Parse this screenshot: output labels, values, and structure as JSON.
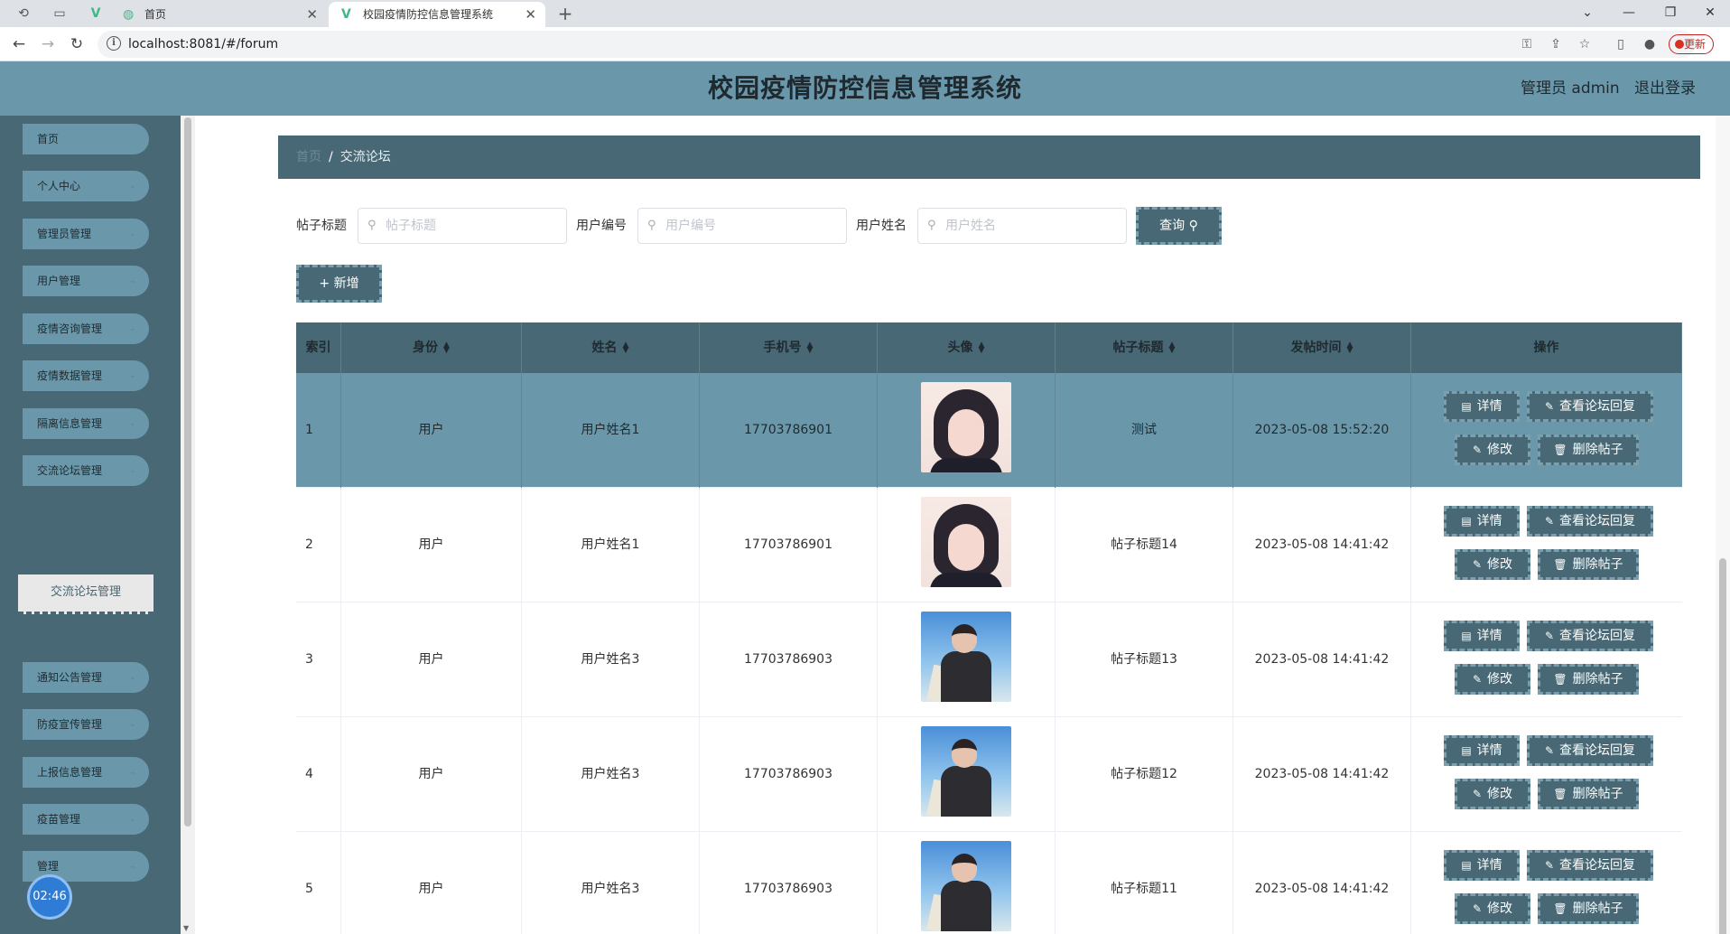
{
  "browser": {
    "tabs": [
      {
        "title": "首页",
        "active": false
      },
      {
        "title": "校园疫情防控信息管理系统",
        "active": true
      }
    ],
    "url": "localhost:8081/#/forum",
    "update_label": "更新"
  },
  "header": {
    "title": "校园疫情防控信息管理系统",
    "admin": "管理员 admin",
    "logout": "退出登录"
  },
  "sidebar": {
    "items": [
      {
        "label": "首页",
        "has_children": false
      },
      {
        "label": "个人中心",
        "has_children": true
      },
      {
        "label": "管理员管理",
        "has_children": true
      },
      {
        "label": "用户管理",
        "has_children": true
      },
      {
        "label": "疫情咨询管理",
        "has_children": true
      },
      {
        "label": "疫情数据管理",
        "has_children": true
      },
      {
        "label": "隔离信息管理",
        "has_children": true
      },
      {
        "label": "交流论坛管理",
        "has_children": true
      },
      {
        "label": "通知公告管理",
        "has_children": true
      },
      {
        "label": "防疫宣传管理",
        "has_children": true
      },
      {
        "label": "上报信息管理",
        "has_children": true
      },
      {
        "label": "疫苗管理",
        "has_children": true
      },
      {
        "label": "管理",
        "has_children": true
      }
    ],
    "active_sub": "交流论坛管理",
    "clock": "02:46"
  },
  "breadcrumb": {
    "home": "首页",
    "current": "交流论坛"
  },
  "search": {
    "fields": [
      {
        "label": "帖子标题",
        "placeholder": "帖子标题"
      },
      {
        "label": "用户编号",
        "placeholder": "用户编号"
      },
      {
        "label": "用户姓名",
        "placeholder": "用户姓名"
      }
    ],
    "query_label": "查询",
    "add_label": "+ 新增"
  },
  "table": {
    "columns": [
      "索引",
      "身份",
      "姓名",
      "手机号",
      "头像",
      "帖子标题",
      "发帖时间",
      "操作"
    ],
    "rows": [
      {
        "index": "1",
        "role": "用户",
        "name": "用户姓名1",
        "phone": "17703786901",
        "avatar": "girl",
        "title": "测试",
        "time": "2023-05-08 15:52:20"
      },
      {
        "index": "2",
        "role": "用户",
        "name": "用户姓名1",
        "phone": "17703786901",
        "avatar": "girl",
        "title": "帖子标题14",
        "time": "2023-05-08 14:41:42"
      },
      {
        "index": "3",
        "role": "用户",
        "name": "用户姓名3",
        "phone": "17703786903",
        "avatar": "boy",
        "title": "帖子标题13",
        "time": "2023-05-08 14:41:42"
      },
      {
        "index": "4",
        "role": "用户",
        "name": "用户姓名3",
        "phone": "17703786903",
        "avatar": "boy",
        "title": "帖子标题12",
        "time": "2023-05-08 14:41:42"
      },
      {
        "index": "5",
        "role": "用户",
        "name": "用户姓名3",
        "phone": "17703786903",
        "avatar": "boy",
        "title": "帖子标题11",
        "time": "2023-05-08 14:41:42"
      }
    ],
    "actions": {
      "detail": "详情",
      "view_replies": "查看论坛回复",
      "edit": "修改",
      "delete": "删除帖子"
    }
  },
  "colors": {
    "header": "#6a98aa",
    "sidebar": "#476874",
    "row_highlight": "#6a98aa"
  }
}
